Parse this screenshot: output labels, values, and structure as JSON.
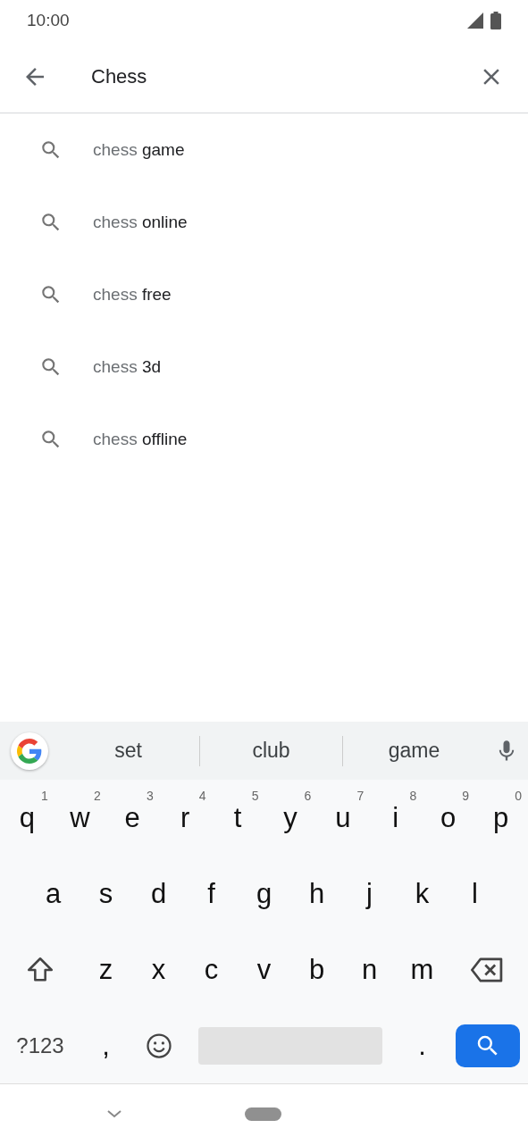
{
  "status_bar": {
    "time": "10:00"
  },
  "search": {
    "value": "Chess"
  },
  "suggestions": [
    {
      "typed": "chess",
      "completion": "game"
    },
    {
      "typed": "chess",
      "completion": "online"
    },
    {
      "typed": "chess",
      "completion": "free"
    },
    {
      "typed": "chess",
      "completion": "3d"
    },
    {
      "typed": "chess",
      "completion": "offline"
    }
  ],
  "keyboard": {
    "word_suggestions": [
      "set",
      "club",
      "game"
    ],
    "key_rows": [
      {
        "keys": [
          {
            "kind": "letter",
            "label": "q",
            "hint": "1"
          },
          {
            "kind": "letter",
            "label": "w",
            "hint": "2"
          },
          {
            "kind": "letter",
            "label": "e",
            "hint": "3"
          },
          {
            "kind": "letter",
            "label": "r",
            "hint": "4"
          },
          {
            "kind": "letter",
            "label": "t",
            "hint": "5"
          },
          {
            "kind": "letter",
            "label": "y",
            "hint": "6"
          },
          {
            "kind": "letter",
            "label": "u",
            "hint": "7"
          },
          {
            "kind": "letter",
            "label": "i",
            "hint": "8"
          },
          {
            "kind": "letter",
            "label": "o",
            "hint": "9"
          },
          {
            "kind": "letter",
            "label": "p",
            "hint": "0"
          }
        ]
      },
      {
        "keys": [
          {
            "kind": "letter",
            "label": "a"
          },
          {
            "kind": "letter",
            "label": "s"
          },
          {
            "kind": "letter",
            "label": "d"
          },
          {
            "kind": "letter",
            "label": "f"
          },
          {
            "kind": "letter",
            "label": "g"
          },
          {
            "kind": "letter",
            "label": "h"
          },
          {
            "kind": "letter",
            "label": "j"
          },
          {
            "kind": "letter",
            "label": "k"
          },
          {
            "kind": "letter",
            "label": "l"
          }
        ]
      },
      {
        "keys": [
          {
            "kind": "shift"
          },
          {
            "kind": "letter",
            "label": "z"
          },
          {
            "kind": "letter",
            "label": "x"
          },
          {
            "kind": "letter",
            "label": "c"
          },
          {
            "kind": "letter",
            "label": "v"
          },
          {
            "kind": "letter",
            "label": "b"
          },
          {
            "kind": "letter",
            "label": "n"
          },
          {
            "kind": "letter",
            "label": "m"
          },
          {
            "kind": "backspace"
          }
        ]
      },
      {
        "keys": [
          {
            "kind": "symbols",
            "label": "?123"
          },
          {
            "kind": "punct",
            "label": ","
          },
          {
            "kind": "emoji"
          },
          {
            "kind": "space"
          },
          {
            "kind": "punct",
            "label": "."
          },
          {
            "kind": "search"
          }
        ]
      }
    ]
  }
}
